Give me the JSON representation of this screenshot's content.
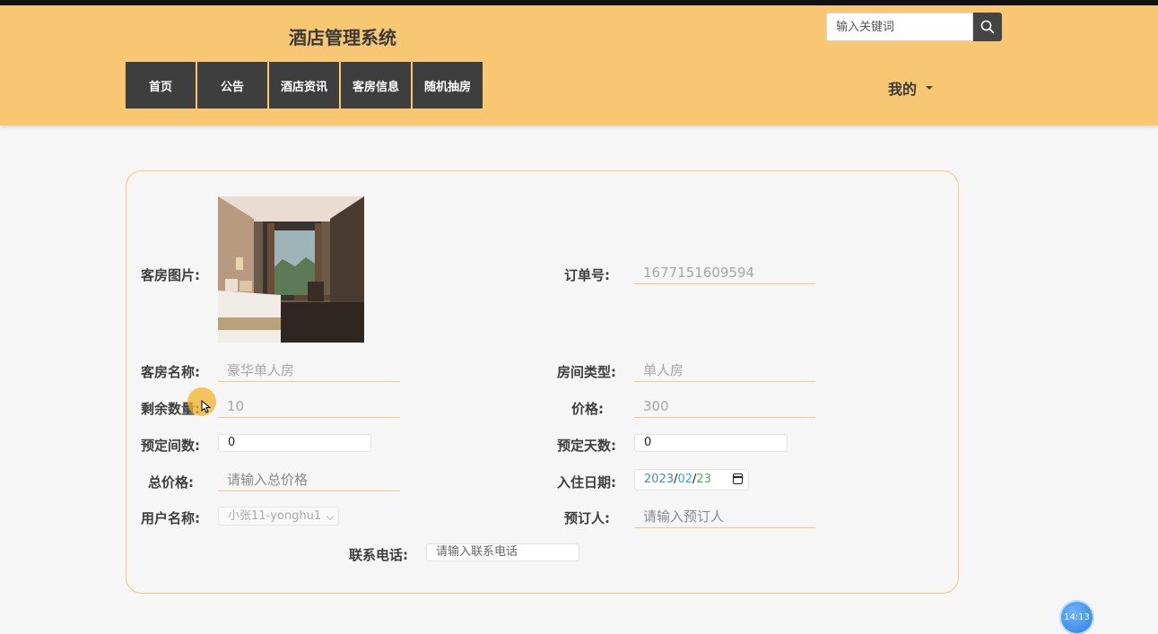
{
  "header": {
    "site_title": "酒店管理系统",
    "search_placeholder": "输入关键词",
    "search_icon": "search-icon",
    "nav": [
      {
        "label": "首页"
      },
      {
        "label": "公告"
      },
      {
        "label": "酒店资讯"
      },
      {
        "label": "客房信息"
      },
      {
        "label": "随机抽房"
      }
    ],
    "user_menu_label": "我的"
  },
  "form": {
    "room_image_label": "客房图片:",
    "order_no_label": "订单号:",
    "order_no_value": "1677151609594",
    "room_name_label": "客房名称:",
    "room_name_value": "豪华单人房",
    "room_type_label": "房间类型:",
    "room_type_value": "单人房",
    "remaining_label": "剩余数量:",
    "remaining_value": "10",
    "price_label": "价格:",
    "price_value": "300",
    "booked_rooms_label": "预定间数:",
    "booked_rooms_value": "0",
    "booked_days_label": "预定天数:",
    "booked_days_value": "0",
    "total_price_label": "总价格:",
    "total_price_placeholder": "请输入总价格",
    "checkin_date_label": "入住日期:",
    "checkin_date": {
      "year": "2023",
      "month": "02",
      "day": "23",
      "sep": "/"
    },
    "username_label": "用户名称:",
    "username_value": "小张11-yonghu1",
    "booker_label": "预订人:",
    "booker_placeholder": "请输入预订人",
    "phone_label": "联系电话:",
    "phone_placeholder": "请输入联系电话"
  },
  "clock": {
    "time": "14:13"
  },
  "colors": {
    "header_bg": "#f7c773",
    "nav_bg": "#3e3e3e",
    "card_border": "#f4c77d",
    "cursor_highlight": "#f3b22a",
    "clock_bg": "#2a7ee0"
  }
}
